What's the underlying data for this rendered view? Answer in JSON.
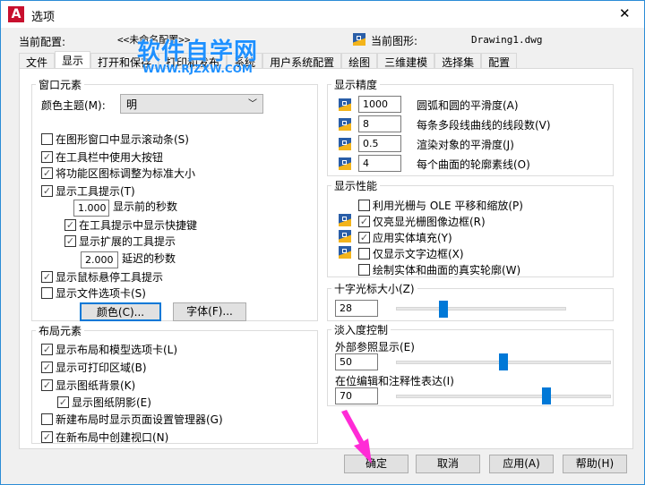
{
  "window": {
    "title": "选项",
    "close": "✕"
  },
  "header": {
    "profile_label": "当前配置:",
    "profile_value": "<<未命名配置>>",
    "drawing_label": "当前图形:",
    "drawing_value": "Drawing1.dwg"
  },
  "watermark": {
    "line1": "软件自学网",
    "line2": "WWW.RJZXW.COM"
  },
  "tabs": [
    "文件",
    "显示",
    "打开和保存",
    "打印和发布",
    "系统",
    "用户系统配置",
    "绘图",
    "三维建模",
    "选择集",
    "配置"
  ],
  "window_elements": {
    "title": "窗口元素",
    "theme_label": "颜色主题(M):",
    "theme_value": "明",
    "opts": [
      {
        "label": "在图形窗口中显示滚动条(S)",
        "checked": false
      },
      {
        "label": "在工具栏中使用大按钮",
        "checked": true
      },
      {
        "label": "将功能区图标调整为标准大小",
        "checked": true
      },
      {
        "label": "显示工具提示(T)",
        "checked": true
      }
    ],
    "tip_delay": "1.000",
    "tip_delay_label": "显示前的秒数",
    "shortcut": {
      "label": "在工具提示中显示快捷键",
      "checked": true
    },
    "extended": {
      "label": "显示扩展的工具提示",
      "checked": true
    },
    "ext_delay": "2.000",
    "ext_delay_label": "延迟的秒数",
    "rollover": {
      "label": "显示鼠标悬停工具提示",
      "checked": true
    },
    "filetabs": {
      "label": "显示文件选项卡(S)",
      "checked": false
    },
    "colors_btn": "颜色(C)...",
    "fonts_btn": "字体(F)..."
  },
  "layout_elements": {
    "title": "布局元素",
    "opts": [
      {
        "label": "显示布局和模型选项卡(L)",
        "checked": true
      },
      {
        "label": "显示可打印区域(B)",
        "checked": true
      },
      {
        "label": "显示图纸背景(K)",
        "checked": true
      },
      {
        "label": "显示图纸阴影(E)",
        "checked": true
      },
      {
        "label": "新建布局时显示页面设置管理器(G)",
        "checked": false
      },
      {
        "label": "在新布局中创建视口(N)",
        "checked": true
      }
    ]
  },
  "resolution": {
    "title": "显示精度",
    "rows": [
      {
        "value": "1000",
        "label": "圆弧和圆的平滑度(A)"
      },
      {
        "value": "8",
        "label": "每条多段线曲线的线段数(V)"
      },
      {
        "value": "0.5",
        "label": "渲染对象的平滑度(J)"
      },
      {
        "value": "4",
        "label": "每个曲面的轮廓素线(O)"
      }
    ]
  },
  "performance": {
    "title": "显示性能",
    "opts": [
      {
        "label": "利用光栅与 OLE 平移和缩放(P)",
        "checked": false,
        "icon": false
      },
      {
        "label": "仅亮显光栅图像边框(R)",
        "checked": true,
        "icon": true
      },
      {
        "label": "应用实体填充(Y)",
        "checked": true,
        "icon": true
      },
      {
        "label": "仅显示文字边框(X)",
        "checked": false,
        "icon": true
      },
      {
        "label": "绘制实体和曲面的真实轮廓(W)",
        "checked": false,
        "icon": false
      }
    ]
  },
  "crosshair": {
    "title": "十字光标大小(Z)",
    "value": "28",
    "percent": 28
  },
  "fade": {
    "title": "淡入度控制",
    "xref_label": "外部参照显示(E)",
    "xref_value": "50",
    "xref_percent": 50,
    "inplace_label": "在位编辑和注释性表达(I)",
    "inplace_value": "70",
    "inplace_percent": 70
  },
  "buttons": {
    "ok": "确定",
    "cancel": "取消",
    "apply": "应用(A)",
    "help": "帮助(H)"
  }
}
